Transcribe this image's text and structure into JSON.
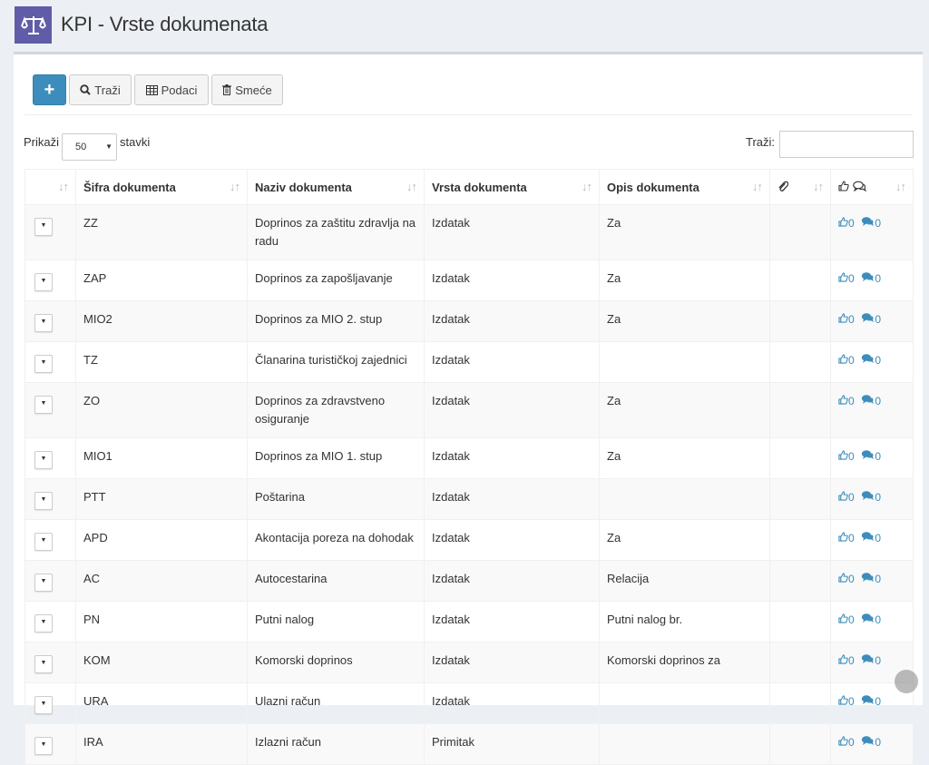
{
  "header": {
    "title": "KPI - Vrste dokumenata"
  },
  "toolbar": {
    "add_label": "+",
    "search_label": "Traži",
    "data_label": "Podaci",
    "trash_label": "Smeće"
  },
  "length": {
    "prefix": "Prikaži",
    "value": "50",
    "suffix": "stavki"
  },
  "search": {
    "label": "Traži:",
    "value": ""
  },
  "table": {
    "columns": [
      "Šifra dokumenta",
      "Naziv dokumenta",
      "Vrsta dokumenta",
      "Opis dokumenta"
    ],
    "rows": [
      {
        "sifra": "ZZ",
        "naziv": "Doprinos za zaštitu zdravlja na radu",
        "vrsta": "Izdatak",
        "opis": "Za",
        "likes": "0",
        "comments": "0"
      },
      {
        "sifra": "ZAP",
        "naziv": "Doprinos za zapošljavanje",
        "vrsta": "Izdatak",
        "opis": "Za",
        "likes": "0",
        "comments": "0"
      },
      {
        "sifra": "MIO2",
        "naziv": "Doprinos za MIO 2. stup",
        "vrsta": "Izdatak",
        "opis": "Za",
        "likes": "0",
        "comments": "0"
      },
      {
        "sifra": "TZ",
        "naziv": "Članarina turističkoj zajednici",
        "vrsta": "Izdatak",
        "opis": "",
        "likes": "0",
        "comments": "0"
      },
      {
        "sifra": "ZO",
        "naziv": "Doprinos za zdravstveno osiguranje",
        "vrsta": "Izdatak",
        "opis": "Za",
        "likes": "0",
        "comments": "0"
      },
      {
        "sifra": "MIO1",
        "naziv": "Doprinos za MIO 1. stup",
        "vrsta": "Izdatak",
        "opis": "Za",
        "likes": "0",
        "comments": "0"
      },
      {
        "sifra": "PTT",
        "naziv": "Poštarina",
        "vrsta": "Izdatak",
        "opis": "",
        "likes": "0",
        "comments": "0"
      },
      {
        "sifra": "APD",
        "naziv": "Akontacija poreza na dohodak",
        "vrsta": "Izdatak",
        "opis": "Za",
        "likes": "0",
        "comments": "0"
      },
      {
        "sifra": "AC",
        "naziv": "Autocestarina",
        "vrsta": "Izdatak",
        "opis": "Relacija",
        "likes": "0",
        "comments": "0"
      },
      {
        "sifra": "PN",
        "naziv": "Putni nalog",
        "vrsta": "Izdatak",
        "opis": "Putni nalog br.",
        "likes": "0",
        "comments": "0"
      },
      {
        "sifra": "KOM",
        "naziv": "Komorski doprinos",
        "vrsta": "Izdatak",
        "opis": "Komorski doprinos za",
        "likes": "0",
        "comments": "0"
      },
      {
        "sifra": "URA",
        "naziv": "Ulazni račun",
        "vrsta": "Izdatak",
        "opis": "",
        "likes": "0",
        "comments": "0"
      },
      {
        "sifra": "IRA",
        "naziv": "Izlazni račun",
        "vrsta": "Primitak",
        "opis": "",
        "likes": "0",
        "comments": "0"
      }
    ]
  },
  "icons": {
    "logo": "balance-scale-icon",
    "search": "search-icon",
    "data": "table-icon",
    "trash": "trash-icon",
    "attachment": "paperclip-icon",
    "like": "thumbs-up-icon",
    "comment": "comments-icon"
  },
  "colors": {
    "accent": "#3c8dbc",
    "logo_bg": "#605ca8"
  }
}
